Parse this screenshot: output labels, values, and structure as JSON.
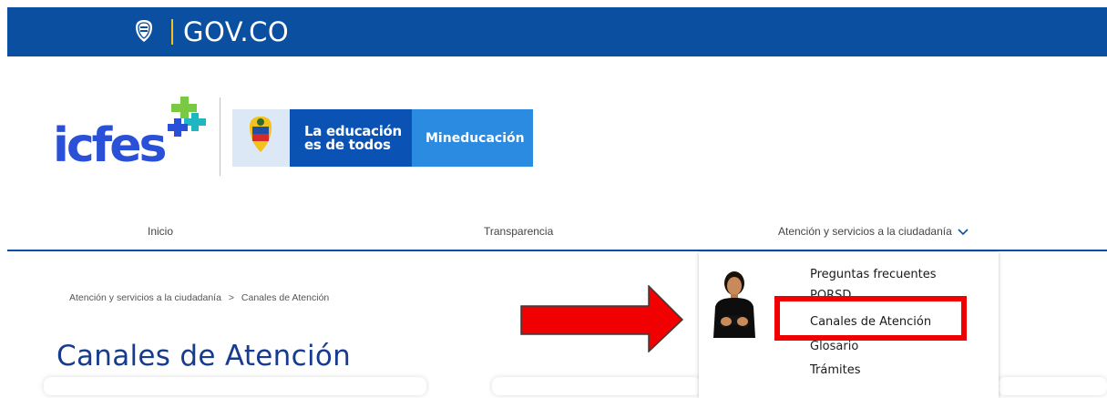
{
  "gov_bar": {
    "title": "GOV.CO",
    "background": "#0a4fa0",
    "seal_icon": "colombia-coat-of-arms-icon"
  },
  "logos": {
    "icfes": "icfes",
    "ministry_slogan_line1": "La educación",
    "ministry_slogan_line2": "es de todos",
    "ministry_name": "Mineducación"
  },
  "nav": {
    "items": [
      {
        "label": "Inicio"
      },
      {
        "label": "Transparencia"
      },
      {
        "label": "Atención y servicios a la ciudadanía"
      }
    ],
    "dropdown_icon": "chevron-down-icon",
    "accent": "#0a4fa0"
  },
  "breadcrumb": {
    "parent": "Atención y servicios a la ciudadanía",
    "separator": ">",
    "current": "Canales de Atención"
  },
  "page": {
    "title": "Canales de Atención",
    "title_color": "#163b8f"
  },
  "dropdown_menu": {
    "items": [
      {
        "label": "Preguntas frecuentes"
      },
      {
        "label": "PQRSD"
      },
      {
        "label": "Canales de Atención",
        "highlighted": true
      },
      {
        "label": "Glosario"
      },
      {
        "label": "Trámites"
      }
    ],
    "interpreter_icon": "sign-language-interpreter-icon"
  },
  "annotations": {
    "arrow_color": "#f00000",
    "highlight_color": "#f00000"
  }
}
